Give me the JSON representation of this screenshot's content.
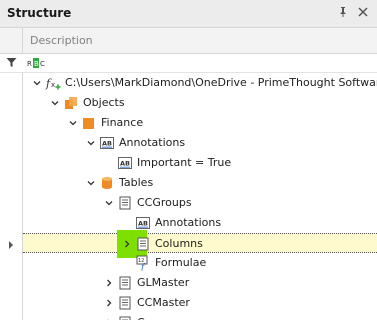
{
  "header": {
    "title": "Structure",
    "pin_icon": "pin-icon",
    "close_icon": "close-icon"
  },
  "column": {
    "description": "Description"
  },
  "filter": {
    "icon": "filter-icon",
    "glyph": "RBC"
  },
  "tree": [
    {
      "label": "C:\\Users\\MarkDiamond\\OneDrive - PrimeThought Software So...",
      "icon": "function-add-icon",
      "chevron": "down",
      "level": 0
    },
    {
      "label": "Objects",
      "icon": "objects-icon",
      "chevron": "down",
      "level": 1
    },
    {
      "label": "Finance",
      "icon": "finance-icon",
      "chevron": "down",
      "level": 2
    },
    {
      "label": "Annotations",
      "icon": "annotation-icon",
      "chevron": "down",
      "level": 3
    },
    {
      "label": "Important = True",
      "icon": "annotation-icon",
      "chevron": "none",
      "level": 4
    },
    {
      "label": "Tables",
      "icon": "database-icon",
      "chevron": "down",
      "level": 3
    },
    {
      "label": "CCGroups",
      "icon": "table-icon",
      "chevron": "down",
      "level": 4
    },
    {
      "label": "Annotations",
      "icon": "annotation-icon",
      "chevron": "none",
      "level": 5
    },
    {
      "label": "Columns",
      "icon": "table-icon",
      "chevron": "right",
      "level": 5,
      "selected": true
    },
    {
      "label": "Formulae",
      "icon": "formula-icon",
      "chevron": "none",
      "level": 5
    },
    {
      "label": "GLMaster",
      "icon": "table-icon",
      "chevron": "right",
      "level": 4
    },
    {
      "label": "CCMaster",
      "icon": "table-icon",
      "chevron": "right",
      "level": 4
    },
    {
      "label": "C...",
      "icon": "table-icon",
      "chevron": "right",
      "level": 4
    }
  ]
}
